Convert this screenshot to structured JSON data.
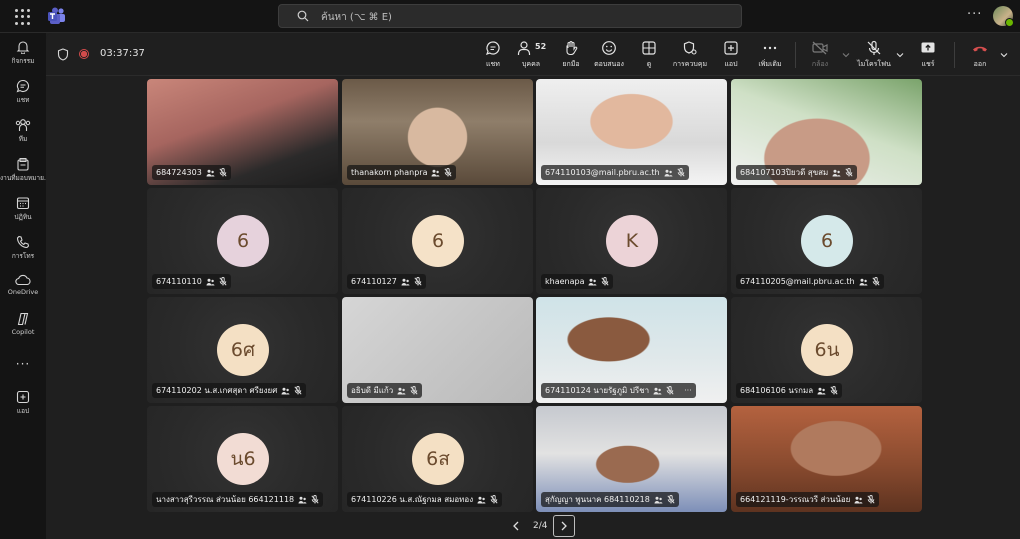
{
  "search": {
    "placeholder": "ค้นหา (⌥ ⌘ E)"
  },
  "rail": [
    {
      "label": "กิจกรรม",
      "icon": "bell-icon"
    },
    {
      "label": "แชท",
      "icon": "chat-icon"
    },
    {
      "label": "ทีม",
      "icon": "teams-icon"
    },
    {
      "label": "งานที่มอบหมาย...",
      "icon": "assignments-icon"
    },
    {
      "label": "ปฏิทิน",
      "icon": "calendar-icon"
    },
    {
      "label": "การโทร",
      "icon": "phone-icon"
    },
    {
      "label": "OneDrive",
      "icon": "onedrive-icon"
    },
    {
      "label": "Copilot",
      "icon": "copilot-icon"
    },
    {
      "label": "แอป",
      "icon": "add-apps-icon"
    }
  ],
  "call": {
    "timer": "03:37:37",
    "participant_count": "52",
    "toolbar": {
      "chat": "แชท",
      "people": "บุคคล",
      "raise": "ยกมือ",
      "react": "ตอบสนอง",
      "view": "ดู",
      "rooms": "การควบคุม",
      "apps": "แอป",
      "more": "เพิ่มเติม",
      "camera": "กล้อง",
      "mic": "ไมโครโฟน",
      "share": "แชร์",
      "leave": "ออก"
    }
  },
  "tiles": [
    {
      "name": "684724303",
      "avatar": "",
      "type": "video"
    },
    {
      "name": "thanakorn phanpra",
      "avatar": "",
      "type": "video"
    },
    {
      "name": "674110103@mail.pbru.ac.th",
      "avatar": "",
      "type": "video"
    },
    {
      "name": "684107103ปิยวดี สุขสม",
      "avatar": "",
      "type": "video"
    },
    {
      "name": "674110110",
      "avatar": "6",
      "type": "avatar",
      "color": "#e6d2dc"
    },
    {
      "name": "674110127",
      "avatar": "6",
      "type": "avatar",
      "color": "#f5e2c8"
    },
    {
      "name": "khaenapa",
      "avatar": "K",
      "type": "avatar",
      "color": "#ecd3d7"
    },
    {
      "name": "674110205@mail.pbru.ac.th",
      "avatar": "6",
      "type": "avatar",
      "color": "#d5e9ea"
    },
    {
      "name": "674110202 น.ส.เกศสุดา ศรียงยศ",
      "avatar": "6ศ",
      "type": "avatar",
      "color": "#f4e0c4"
    },
    {
      "name": "อธิบดี มีแก้ว",
      "avatar": "",
      "type": "video"
    },
    {
      "name": "674110124 นายรัฐภูมิ ปรีชา",
      "avatar": "",
      "type": "video"
    },
    {
      "name": "684106106 นรกมล",
      "avatar": "6น",
      "type": "avatar",
      "color": "#f4e0c4"
    },
    {
      "name": "นางสาวสุรีวรรณ ส่วนน้อย 664121118",
      "avatar": "น6",
      "type": "avatar",
      "color": "#f2dcd4"
    },
    {
      "name": "674110226 น.ส.ณัฐกมล สมอทอง",
      "avatar": "6ส",
      "type": "avatar",
      "color": "#f4e0c4"
    },
    {
      "name": "สุกัญญา พูนนาค 684110218",
      "avatar": "",
      "type": "video"
    },
    {
      "name": "664121119-วรรณวรี ส่วนน้อย",
      "avatar": "",
      "type": "video"
    }
  ],
  "pager": {
    "label": "2/4"
  }
}
